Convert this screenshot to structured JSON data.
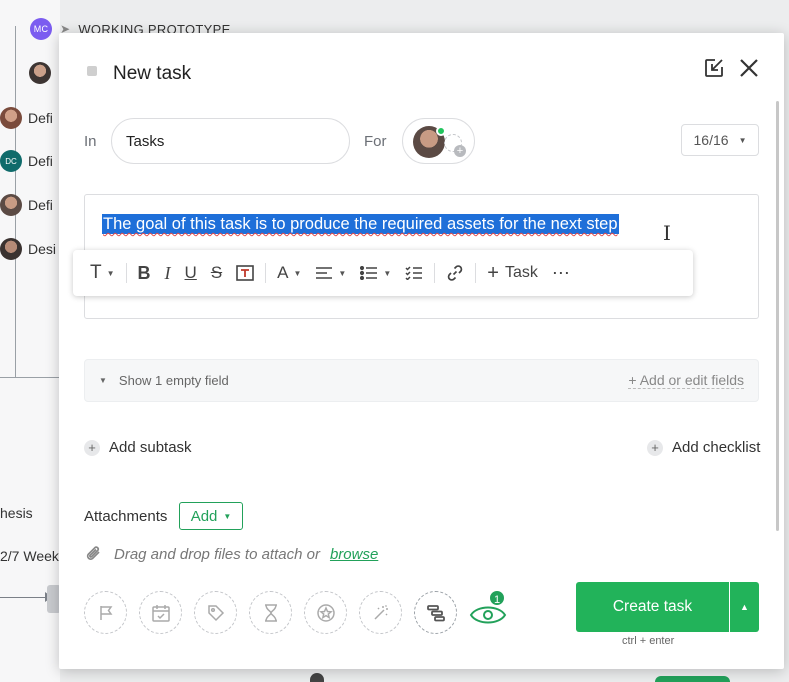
{
  "background": {
    "top_avatar_initials": "MC",
    "top_label": "WORKING PROTOTYPE",
    "rows": [
      {
        "initials": "",
        "text": "Defi"
      },
      {
        "initials": "DC",
        "text": "Defi"
      },
      {
        "initials": "",
        "text": "Defi"
      },
      {
        "initials": "",
        "text": "Desi"
      }
    ],
    "hesis_text": "hesis",
    "week_text": "2/7 Week"
  },
  "modal": {
    "title": "New task",
    "in_label": "In",
    "in_value": "Tasks",
    "for_label": "For",
    "counter": "16/16",
    "description": "The goal of this task is to produce the required assets for the next step",
    "toolbar": {
      "task_label": "Task"
    },
    "empty_field_label": "Show 1 empty field",
    "add_edit_fields": "+ Add or edit fields",
    "add_subtask": "Add subtask",
    "add_checklist": "Add checklist",
    "attachments_label": "Attachments",
    "add_button": "Add",
    "drag_drop_text": "Drag and drop files to attach or",
    "browse_link": "browse",
    "followers_count": "1",
    "create_button": "Create task",
    "shortcut_hint": "ctrl + enter"
  },
  "colors": {
    "accent_green": "#22b35a",
    "selection_blue": "#1e6fd9",
    "avatar_purple": "#7b5cf0",
    "avatar_teal": "#0f6b6b"
  }
}
